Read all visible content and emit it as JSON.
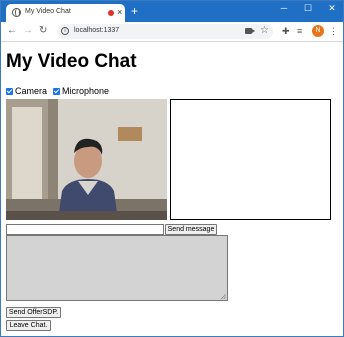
{
  "browser": {
    "tab_title": "My Video Chat",
    "tab_close": "×",
    "new_tab": "+",
    "url": "localhost:1337",
    "profile_initial": "N",
    "window_controls": {
      "minimize": "─",
      "maximize": "☐",
      "close": "✕"
    },
    "nav": {
      "back": "←",
      "forward": "→",
      "reload": "↻"
    },
    "icons": {
      "info": "i",
      "star": "☆",
      "extensions": "✚",
      "reading_list": "≡",
      "menu": "⋮"
    },
    "colors": {
      "titlebar": "#1f6fc5",
      "recording": "#e0302c",
      "avatar": "#e8741c"
    }
  },
  "page": {
    "title": "My Video Chat",
    "camera_label": "Camera",
    "microphone_label": "Microphone",
    "camera_checked": true,
    "microphone_checked": true,
    "message_value": "",
    "send_button": "Send message",
    "offer_button": "Send OfferSDP.",
    "leave_button": "Leave Chat."
  }
}
